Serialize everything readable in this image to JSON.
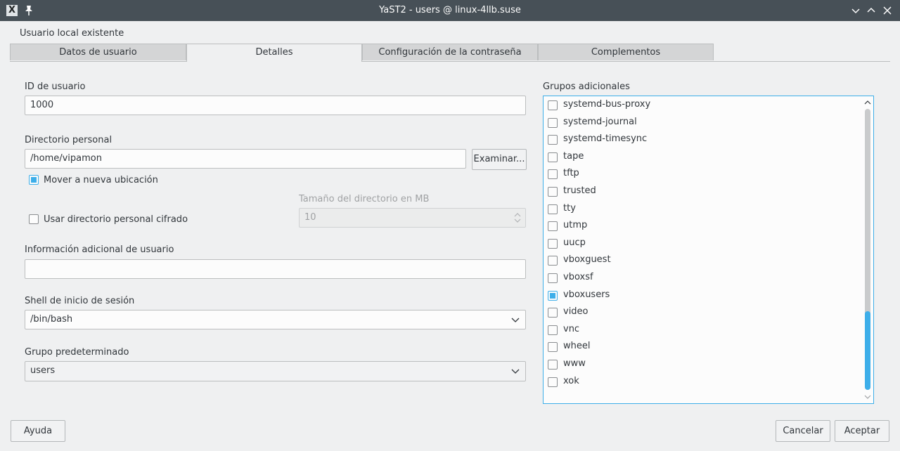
{
  "window": {
    "title": "YaST2 - users @ linux-4llb.suse"
  },
  "page": {
    "heading": "Usuario local existente"
  },
  "tabs": [
    {
      "label": "Datos de usuario",
      "active": false
    },
    {
      "label": "Detalles",
      "active": true
    },
    {
      "label": "Configuración de la contraseña",
      "active": false
    },
    {
      "label": "Complementos",
      "active": false
    }
  ],
  "form": {
    "user_id": {
      "label": "ID de usuario",
      "value": "1000"
    },
    "home_dir": {
      "label": "Directorio personal",
      "value": "/home/vipamon",
      "browse_label": "Examinar..."
    },
    "move_to_new": {
      "label": "Mover a nueva ubicación",
      "checked": true
    },
    "encrypted_home": {
      "label": "Usar directorio personal cifrado",
      "checked": false
    },
    "dir_size": {
      "label": "Tamaño del directorio en MB",
      "value": "10"
    },
    "extra_info": {
      "label": "Información adicional de usuario",
      "value": ""
    },
    "login_shell": {
      "label": "Shell de inicio de sesión",
      "value": "/bin/bash"
    },
    "default_group": {
      "label": "Grupo predeterminado",
      "value": "users"
    }
  },
  "groups": {
    "label": "Grupos adicionales",
    "items": [
      {
        "name": "systemd-bus-proxy",
        "checked": false
      },
      {
        "name": "systemd-journal",
        "checked": false
      },
      {
        "name": "systemd-timesync",
        "checked": false
      },
      {
        "name": "tape",
        "checked": false
      },
      {
        "name": "tftp",
        "checked": false
      },
      {
        "name": "trusted",
        "checked": false
      },
      {
        "name": "tty",
        "checked": false
      },
      {
        "name": "utmp",
        "checked": false
      },
      {
        "name": "uucp",
        "checked": false
      },
      {
        "name": "vboxguest",
        "checked": false
      },
      {
        "name": "vboxsf",
        "checked": false
      },
      {
        "name": "vboxusers",
        "checked": true
      },
      {
        "name": "video",
        "checked": false
      },
      {
        "name": "vnc",
        "checked": false
      },
      {
        "name": "wheel",
        "checked": false
      },
      {
        "name": "www",
        "checked": false
      },
      {
        "name": "xok",
        "checked": false
      }
    ]
  },
  "buttons": {
    "help": "Ayuda",
    "cancel": "Cancelar",
    "accept": "Aceptar"
  },
  "colors": {
    "accent": "#3daee9",
    "titlebar": "#475057",
    "window_bg": "#eff0f1"
  }
}
